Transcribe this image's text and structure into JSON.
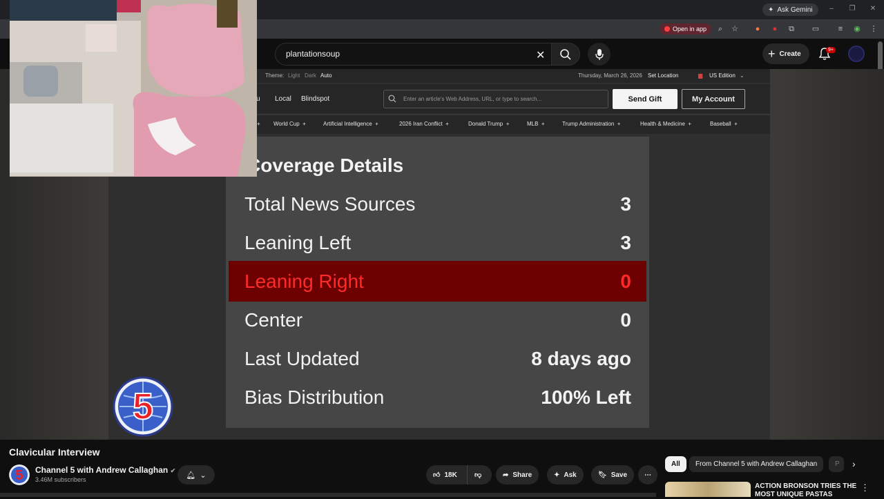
{
  "browser": {
    "ask_gemini": "Ask Gemini",
    "open_in_app": "Open in app"
  },
  "youtube": {
    "search_value": "plantationsoup",
    "create_label": "Create",
    "notification_badge": "9+",
    "video_title": "Clavicular Interview",
    "channel_name": "Channel 5 with Andrew Callaghan",
    "subscribers": "3.46M subscribers",
    "like_count": "18K",
    "share_label": "Share",
    "ask_label": "Ask",
    "save_label": "Save",
    "chips": [
      "All",
      "From Channel 5 with Andrew Callaghan",
      "P"
    ],
    "recommended_title": "ACTION BRONSON TRIES THE MOST UNIQUE PASTAS"
  },
  "ground_news": {
    "theme_label": "Theme:",
    "theme_options": [
      "Light",
      "Dark",
      "Auto"
    ],
    "date": "Thursday, March 26, 2026",
    "set_location": "Set Location",
    "edition": "US Edition",
    "nav_partial": "u",
    "nav_links": [
      "Local",
      "Blindspot"
    ],
    "url_placeholder": "Enter an article's Web Address, URL, or type to search...",
    "send_gift": "Send Gift",
    "my_account": "My Account",
    "topics": [
      "World Cup",
      "Artificial Intelligence",
      "2026 Iran Conflict",
      "Donald Trump",
      "MLB",
      "Trump Administration",
      "Health & Medicine",
      "Baseball"
    ],
    "coverage": {
      "title": "Coverage Details",
      "rows": [
        {
          "label": "Total News Sources",
          "value": "3"
        },
        {
          "label": "Leaning Left",
          "value": "3"
        },
        {
          "label": "Leaning Right",
          "value": "0"
        },
        {
          "label": "Center",
          "value": "0"
        },
        {
          "label": "Last Updated",
          "value": "8 days ago"
        },
        {
          "label": "Bias Distribution",
          "value": "100% Left"
        }
      ]
    }
  },
  "colors": {
    "yt_bg": "#0f0f0f",
    "highlight_bg": "#6d0000",
    "highlight_text": "#ff2a2a",
    "youtube_red": "#cc0000"
  }
}
